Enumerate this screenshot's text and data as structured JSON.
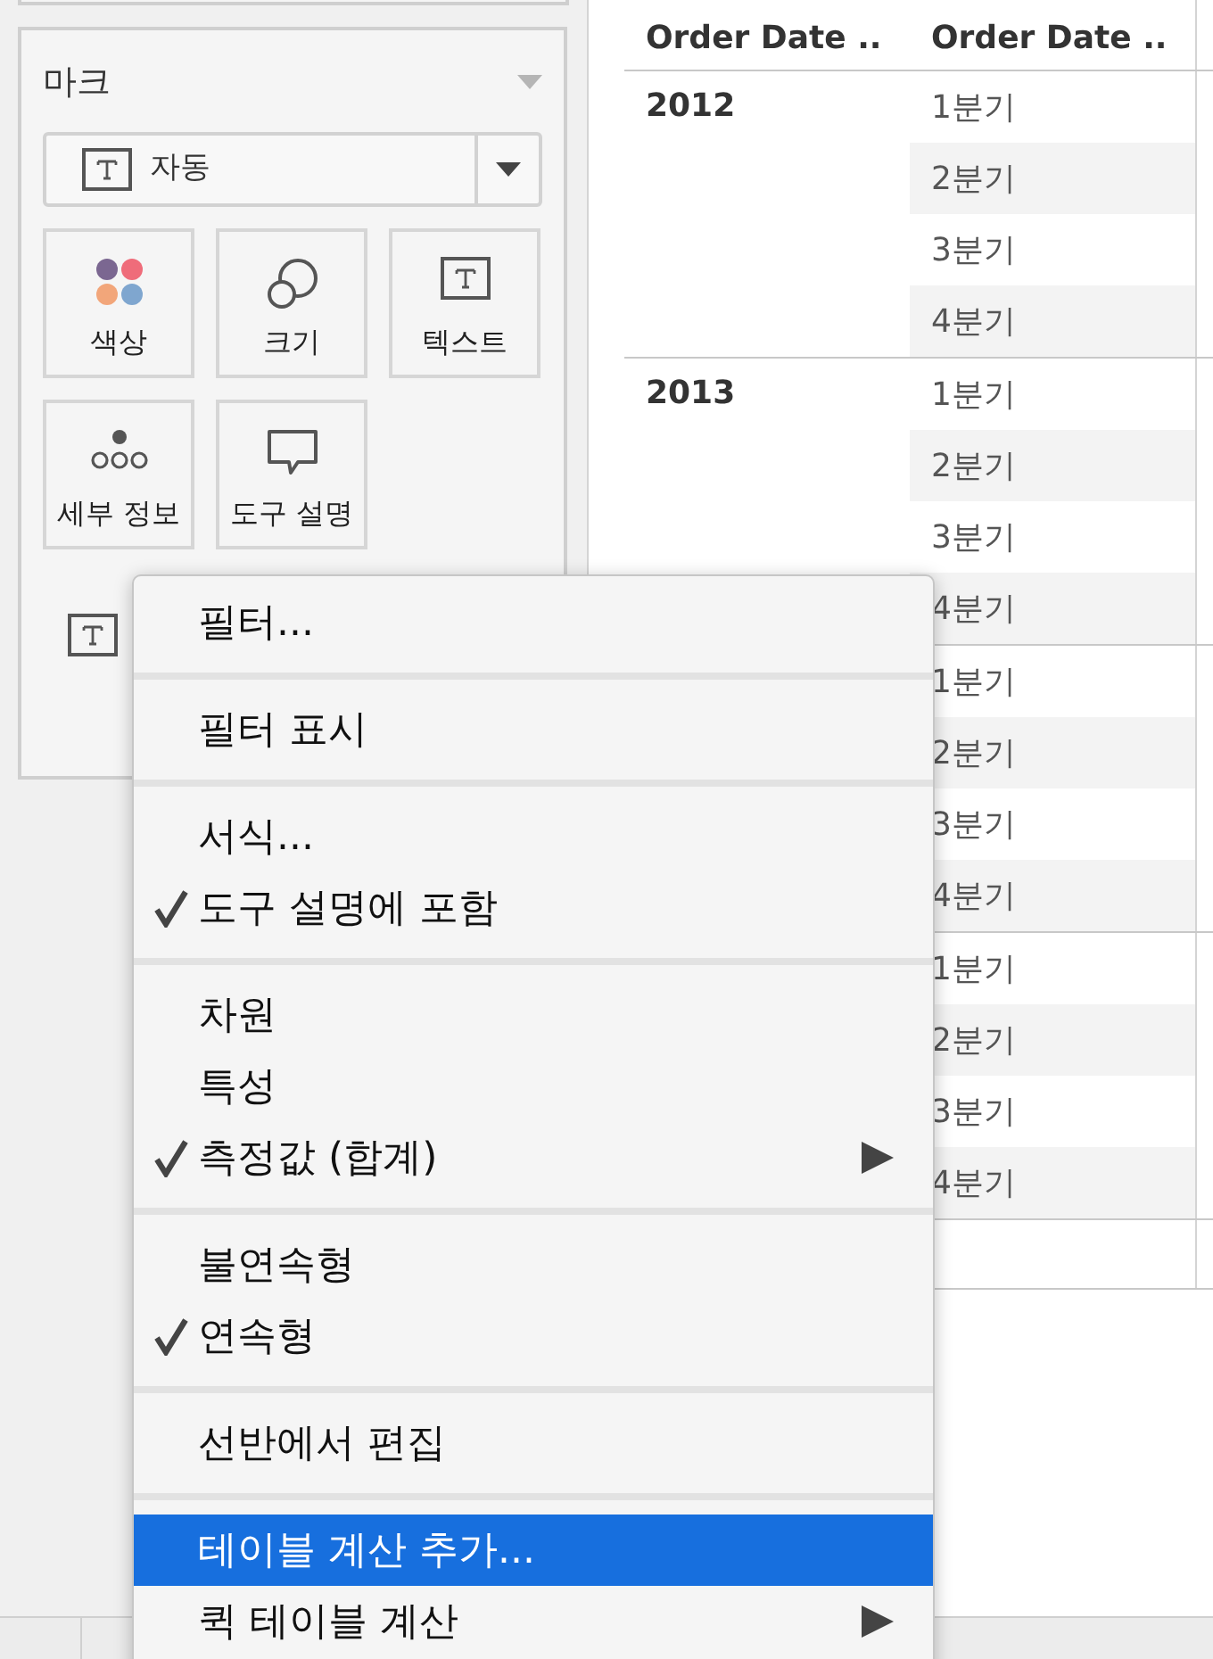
{
  "marks_card": {
    "title": "마크",
    "mark_type": "자동",
    "buttons": [
      {
        "kind": "color",
        "label": "색상"
      },
      {
        "kind": "size",
        "label": "크기"
      },
      {
        "kind": "text",
        "label": "텍스트"
      },
      {
        "kind": "detail",
        "label": "세부 정보"
      },
      {
        "kind": "tooltip",
        "label": "도구 설명"
      }
    ]
  },
  "table": {
    "columns": [
      "Order Date ..",
      "Order Date .."
    ],
    "groups": [
      {
        "year": "2012",
        "quarters": [
          "1분기",
          "2분기",
          "3분기",
          "4분기"
        ]
      },
      {
        "year": "2013",
        "quarters": [
          "1분기",
          "2분기",
          "3분기",
          "4분기"
        ]
      },
      {
        "quarters": [
          "1분기",
          "2분기",
          "3분기",
          "4분기"
        ]
      },
      {
        "quarters": [
          "1분기",
          "2분기",
          "3분기",
          "4분기"
        ]
      }
    ]
  },
  "context_menu": {
    "sections": [
      [
        {
          "label": "필터...",
          "checked": false,
          "selected": false,
          "submenu": false
        }
      ],
      [
        {
          "label": "필터 표시",
          "checked": false,
          "selected": false,
          "submenu": false
        }
      ],
      [
        {
          "label": "서식...",
          "checked": false,
          "selected": false,
          "submenu": false
        },
        {
          "label": "도구 설명에 포함",
          "checked": true,
          "selected": false,
          "submenu": false
        }
      ],
      [
        {
          "label": "차원",
          "checked": false,
          "selected": false,
          "submenu": false
        },
        {
          "label": "특성",
          "checked": false,
          "selected": false,
          "submenu": false
        },
        {
          "label": "측정값 (합계)",
          "checked": true,
          "selected": false,
          "submenu": true
        }
      ],
      [
        {
          "label": "불연속형",
          "checked": false,
          "selected": false,
          "submenu": false
        },
        {
          "label": "연속형",
          "checked": true,
          "selected": false,
          "submenu": false
        }
      ],
      [
        {
          "label": "선반에서 편집",
          "checked": false,
          "selected": false,
          "submenu": false
        }
      ],
      [
        {
          "label": "테이블 계산 추가...",
          "checked": false,
          "selected": true,
          "submenu": false
        },
        {
          "label": "퀵 테이블 계산",
          "checked": false,
          "selected": false,
          "submenu": true
        }
      ]
    ]
  }
}
